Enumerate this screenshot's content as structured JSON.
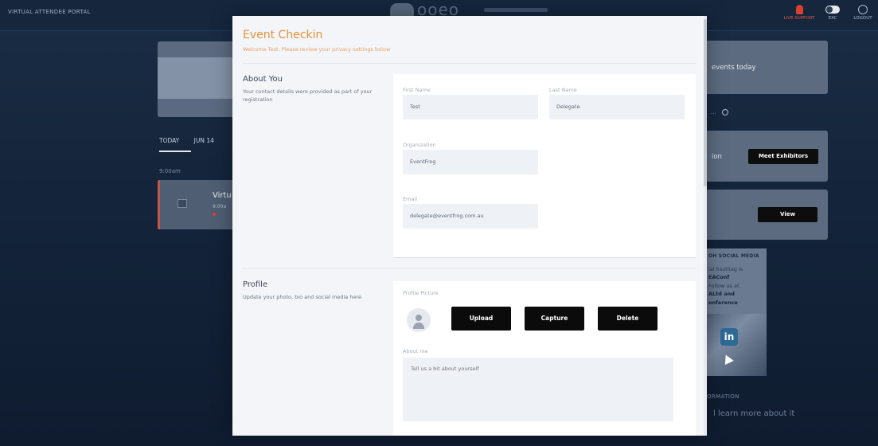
{
  "portal": {
    "title": "VIRTUAL ATTENDEE PORTAL",
    "live_support": "LIVE SUPPORT",
    "toggle_label": "EXC",
    "logout_label": "LOGOUT",
    "day_tabs": [
      "TODAY",
      "JUN 14"
    ],
    "time_label": "9:00am",
    "session_title": "Virtu",
    "session_time": "9:00a",
    "right_card_1_text": "events today",
    "right_link": "...",
    "right_card_2_text": "ion",
    "meet_exhibitors": "Meet Exhibitors",
    "view": "View",
    "social": {
      "heading": "OH SOCIAL MEDIA",
      "lines": [
        "ial hashtag is",
        "EAConf",
        "Follow us at",
        "ALtd and",
        "onference"
      ]
    },
    "info_label": "ORMATION",
    "info_text": "l learn more about it"
  },
  "modal": {
    "title": "Event Checkin",
    "subtitle": "Welcome Test. Please review your privacy settings below",
    "about": {
      "title": "About You",
      "description": "Your contact details were provided as part of your registration",
      "first_name_label": "First Name",
      "first_name_value": "Test",
      "last_name_label": "Last Name",
      "last_name_value": "Delegate",
      "organization_label": "Organization",
      "organization_value": "EventFrog",
      "email_label": "Email",
      "email_value": "delegate@eventfrog.com.au"
    },
    "profile": {
      "title": "Profile",
      "description": "Update your photo, bio and social media here",
      "picture_label": "Profile Picture",
      "upload": "Upload",
      "capture": "Capture",
      "delete": "Delete",
      "about_me_label": "About me",
      "about_me_placeholder": "Tell us a bit about yourself"
    }
  }
}
